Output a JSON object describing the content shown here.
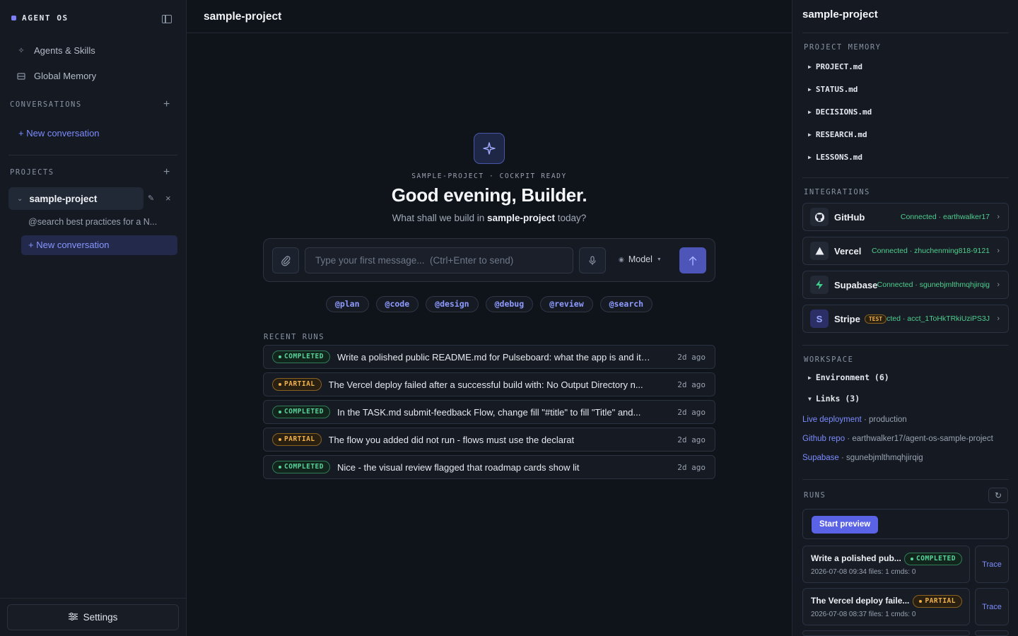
{
  "brand": {
    "title": "AGENT OS"
  },
  "nav": {
    "agents": "Agents & Skills",
    "memory": "Global Memory"
  },
  "conversations": {
    "label": "CONVERSATIONS",
    "new": "+ New conversation"
  },
  "projects": {
    "label": "PROJECTS",
    "current": "sample-project",
    "sub_item": "@search best practices for a N...",
    "sub_new": "+ New conversation"
  },
  "settings": {
    "label": "Settings"
  },
  "main": {
    "title": "sample-project",
    "kicker": "SAMPLE-PROJECT · COCKPIT READY",
    "greeting": "Good evening, Builder.",
    "sub_pre": "What shall we build in ",
    "sub_bold": "sample-project",
    "sub_post": " today?",
    "input_placeholder": "Type your first message...  (Ctrl+Enter to send)",
    "model_label": "Model",
    "chips": [
      "@plan",
      "@code",
      "@design",
      "@debug",
      "@review",
      "@search"
    ],
    "runs_label": "RECENT RUNS",
    "runs": [
      {
        "status": "COMPLETED",
        "text": "Write a polished public README.md for Pulseboard: what the app is and its fea...",
        "time": "2d ago"
      },
      {
        "status": "PARTIAL",
        "text": "The Vercel deploy failed after a successful build with: No Output Directory n...",
        "time": "2d ago"
      },
      {
        "status": "COMPLETED",
        "text": "In the TASK.md submit-feedback Flow, change fill \"#title\" to fill \"Title\" and...",
        "time": "2d ago"
      },
      {
        "status": "PARTIAL",
        "text": "The flow you added did not run - flows must use the declarat",
        "time": "2d ago"
      },
      {
        "status": "COMPLETED",
        "text": "Nice - the visual review flagged that roadmap cards show lit",
        "time": "2d ago"
      }
    ]
  },
  "right": {
    "title": "sample-project",
    "memory_label": "PROJECT MEMORY",
    "memory_files": [
      "PROJECT.md",
      "STATUS.md",
      "DECISIONS.md",
      "RESEARCH.md",
      "LESSONS.md"
    ],
    "integrations_label": "INTEGRATIONS",
    "integrations": [
      {
        "name": "GitHub",
        "status": "Connected · earthwalker17",
        "icon": "github-icon"
      },
      {
        "name": "Vercel",
        "status": "Connected · zhuchenming818-9121",
        "icon": "vercel-icon"
      },
      {
        "name": "Supabase",
        "status": "Connected · sgunebjmlthmqhjirqig",
        "icon": "bolt-icon"
      },
      {
        "name": "Stripe",
        "status": "Connected · acct_1ToHkTRkiUziPS3J",
        "icon": "stripe-icon",
        "badge": "TEST"
      }
    ],
    "workspace_label": "WORKSPACE",
    "env_label": "Environment (6)",
    "links_label": "Links (3)",
    "links": [
      {
        "name": "Live deployment",
        "detail": " · production"
      },
      {
        "name": "Github repo",
        "detail": " · earthwalker17/agent-os-sample-project"
      },
      {
        "name": "Supabase",
        "detail": " · sgunebjmlthmqhjirqig"
      }
    ],
    "runs_label": "RUNS",
    "preview_label": "Start preview",
    "run_cards": [
      {
        "title": "Write a polished pub...",
        "status": "COMPLETED",
        "meta": "2026-07-08 09:34   files: 1   cmds: 0",
        "trace": "Trace"
      },
      {
        "title": "The Vercel deploy faile...",
        "status": "PARTIAL",
        "meta": "2026-07-08 08:37   files: 1   cmds: 0",
        "trace": "Trace"
      }
    ]
  },
  "colors": {
    "accent": "#5a62e6",
    "success": "#4fcf8e",
    "warning": "#f0b04a",
    "link": "#7d8cff"
  }
}
